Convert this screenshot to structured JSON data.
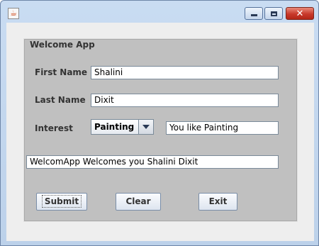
{
  "window": {
    "icon": "java-cup-icon",
    "controls": [
      "minimize-icon",
      "maximize-icon",
      "close-icon"
    ],
    "close_glyph": "✕"
  },
  "panel": {
    "title": "Welcome App"
  },
  "form": {
    "first_name_label": "First Name",
    "first_name_value": "Shalini",
    "last_name_label": "Last Name",
    "last_name_value": "Dixit",
    "interest_label": "Interest",
    "interest_selected": "Painting",
    "interest_message": "You like Painting",
    "welcome_message": "WelcomApp Welcomes you Shalini  Dixit"
  },
  "buttons": {
    "submit": "Submit",
    "clear": "Clear",
    "exit": "Exit"
  }
}
